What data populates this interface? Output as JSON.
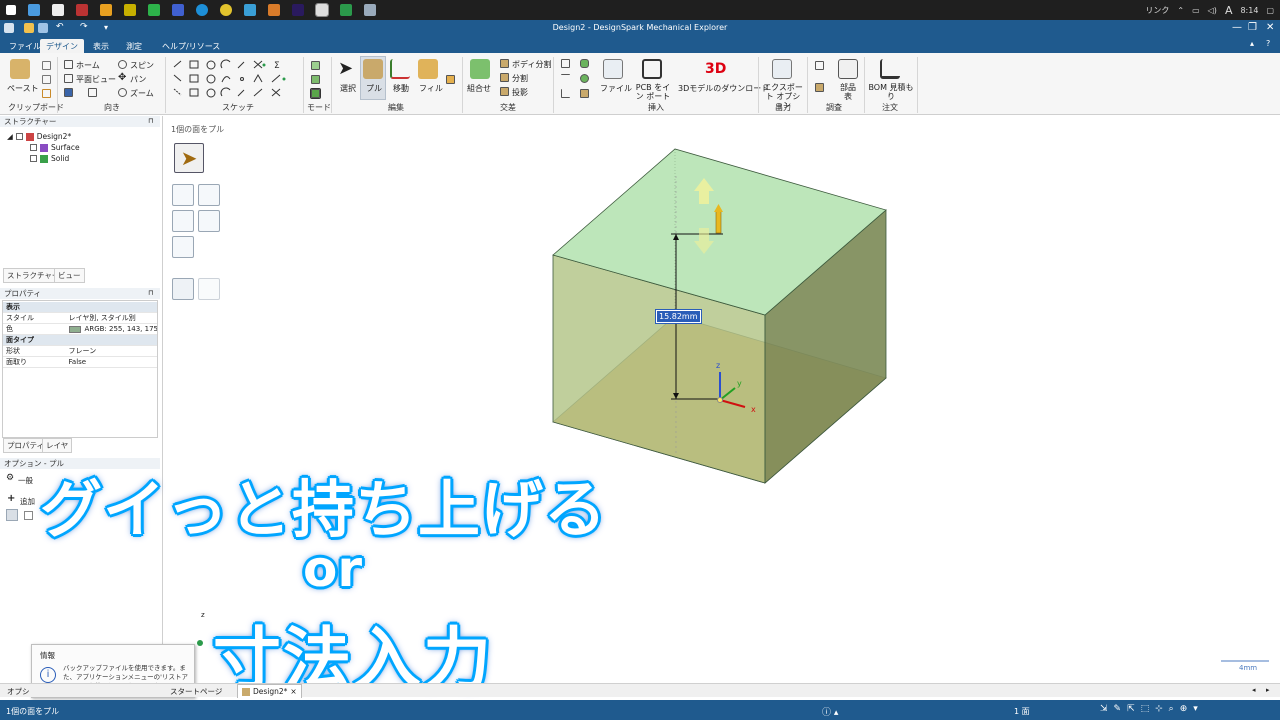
{
  "taskbar": {
    "right": [
      "リンク",
      "A",
      "8:14"
    ]
  },
  "window": {
    "title": "Design2 - DesignSpark Mechanical Explorer"
  },
  "menu_tabs": [
    "ファイル",
    "デザイン",
    "表示",
    "測定",
    "ヘルプ/リソース"
  ],
  "ribbon": {
    "paste": "ペースト",
    "home": "ホーム",
    "spin": "スピン",
    "plane_view": "平面ビュー",
    "pan": "パン",
    "zoom": "ズーム",
    "select": "選択",
    "pull": "プル",
    "move": "移動",
    "fill": "フィル",
    "combine": "組合せ",
    "split_body": "ボディ分割",
    "split": "分割",
    "project": "投影",
    "file": "ファイル",
    "pcb_import": "PCB をイン ポート",
    "dl3d": "3Dモデルのダウンロード",
    "export": "エクスポート オプション",
    "parts": "部品 表",
    "bom": "BOM 見積もり",
    "groups": {
      "clipboard": "クリップボード",
      "orient": "向き",
      "sketch": "スケッチ",
      "mode": "モード",
      "edit": "編集",
      "intersect": "交差",
      "insert": "挿入",
      "output": "出力",
      "investigate": "調査",
      "order": "注文"
    }
  },
  "structure": {
    "header": "ストラクチャー",
    "root": "Design2*",
    "items": [
      "Surface",
      "Solid"
    ],
    "tabs": [
      "ストラクチャー",
      "ビュー"
    ]
  },
  "properties": {
    "header": "プロパティ",
    "sections": [
      {
        "title": "表示",
        "rows": [
          [
            "スタイル",
            "レイヤ別, スタイル別"
          ],
          [
            "色",
            "ARGB: 255, 143, 175"
          ]
        ]
      },
      {
        "title": "面タイプ",
        "rows": [
          [
            "形状",
            "フレーン"
          ],
          [
            "面取り",
            "False"
          ]
        ]
      }
    ],
    "tabs": [
      "プロパティ",
      "レイヤ"
    ]
  },
  "options": {
    "header": "オプション - プル",
    "general": "一般",
    "add": "追加"
  },
  "canvas": {
    "hint": "1個の面をプル",
    "dimension": "15.82mm",
    "scale": "4mm",
    "axes": [
      "z",
      "y",
      "x"
    ]
  },
  "captions": {
    "line1": "グイっと持ち上げる",
    "line2": "or",
    "line3": "寸法入力"
  },
  "info_popup": {
    "title": "情報",
    "text": "バックアップファイルを使用できます。また、アプリケーションメニューの'リストアアイテムを使用してリカバリできます。"
  },
  "doc_tabs": {
    "start": "スタートページ",
    "design": "Design2*",
    "options_tab": "オプシ"
  },
  "status": {
    "left": "1個の面をプル",
    "center": "1 面"
  },
  "colors": {
    "titlebar": "#1f5a8e",
    "face_green": "#a8dca8",
    "face_orange": "#d9a560",
    "caption_glow": "#00a6ff"
  }
}
